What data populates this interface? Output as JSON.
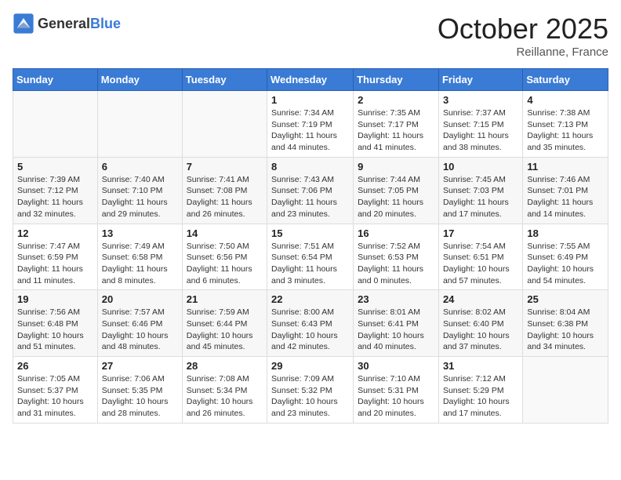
{
  "header": {
    "logo_general": "General",
    "logo_blue": "Blue",
    "month_title": "October 2025",
    "location": "Reillanne, France"
  },
  "days_of_week": [
    "Sunday",
    "Monday",
    "Tuesday",
    "Wednesday",
    "Thursday",
    "Friday",
    "Saturday"
  ],
  "weeks": [
    [
      {
        "day": "",
        "info": ""
      },
      {
        "day": "",
        "info": ""
      },
      {
        "day": "",
        "info": ""
      },
      {
        "day": "1",
        "info": "Sunrise: 7:34 AM\nSunset: 7:19 PM\nDaylight: 11 hours and 44 minutes."
      },
      {
        "day": "2",
        "info": "Sunrise: 7:35 AM\nSunset: 7:17 PM\nDaylight: 11 hours and 41 minutes."
      },
      {
        "day": "3",
        "info": "Sunrise: 7:37 AM\nSunset: 7:15 PM\nDaylight: 11 hours and 38 minutes."
      },
      {
        "day": "4",
        "info": "Sunrise: 7:38 AM\nSunset: 7:13 PM\nDaylight: 11 hours and 35 minutes."
      }
    ],
    [
      {
        "day": "5",
        "info": "Sunrise: 7:39 AM\nSunset: 7:12 PM\nDaylight: 11 hours and 32 minutes."
      },
      {
        "day": "6",
        "info": "Sunrise: 7:40 AM\nSunset: 7:10 PM\nDaylight: 11 hours and 29 minutes."
      },
      {
        "day": "7",
        "info": "Sunrise: 7:41 AM\nSunset: 7:08 PM\nDaylight: 11 hours and 26 minutes."
      },
      {
        "day": "8",
        "info": "Sunrise: 7:43 AM\nSunset: 7:06 PM\nDaylight: 11 hours and 23 minutes."
      },
      {
        "day": "9",
        "info": "Sunrise: 7:44 AM\nSunset: 7:05 PM\nDaylight: 11 hours and 20 minutes."
      },
      {
        "day": "10",
        "info": "Sunrise: 7:45 AM\nSunset: 7:03 PM\nDaylight: 11 hours and 17 minutes."
      },
      {
        "day": "11",
        "info": "Sunrise: 7:46 AM\nSunset: 7:01 PM\nDaylight: 11 hours and 14 minutes."
      }
    ],
    [
      {
        "day": "12",
        "info": "Sunrise: 7:47 AM\nSunset: 6:59 PM\nDaylight: 11 hours and 11 minutes."
      },
      {
        "day": "13",
        "info": "Sunrise: 7:49 AM\nSunset: 6:58 PM\nDaylight: 11 hours and 8 minutes."
      },
      {
        "day": "14",
        "info": "Sunrise: 7:50 AM\nSunset: 6:56 PM\nDaylight: 11 hours and 6 minutes."
      },
      {
        "day": "15",
        "info": "Sunrise: 7:51 AM\nSunset: 6:54 PM\nDaylight: 11 hours and 3 minutes."
      },
      {
        "day": "16",
        "info": "Sunrise: 7:52 AM\nSunset: 6:53 PM\nDaylight: 11 hours and 0 minutes."
      },
      {
        "day": "17",
        "info": "Sunrise: 7:54 AM\nSunset: 6:51 PM\nDaylight: 10 hours and 57 minutes."
      },
      {
        "day": "18",
        "info": "Sunrise: 7:55 AM\nSunset: 6:49 PM\nDaylight: 10 hours and 54 minutes."
      }
    ],
    [
      {
        "day": "19",
        "info": "Sunrise: 7:56 AM\nSunset: 6:48 PM\nDaylight: 10 hours and 51 minutes."
      },
      {
        "day": "20",
        "info": "Sunrise: 7:57 AM\nSunset: 6:46 PM\nDaylight: 10 hours and 48 minutes."
      },
      {
        "day": "21",
        "info": "Sunrise: 7:59 AM\nSunset: 6:44 PM\nDaylight: 10 hours and 45 minutes."
      },
      {
        "day": "22",
        "info": "Sunrise: 8:00 AM\nSunset: 6:43 PM\nDaylight: 10 hours and 42 minutes."
      },
      {
        "day": "23",
        "info": "Sunrise: 8:01 AM\nSunset: 6:41 PM\nDaylight: 10 hours and 40 minutes."
      },
      {
        "day": "24",
        "info": "Sunrise: 8:02 AM\nSunset: 6:40 PM\nDaylight: 10 hours and 37 minutes."
      },
      {
        "day": "25",
        "info": "Sunrise: 8:04 AM\nSunset: 6:38 PM\nDaylight: 10 hours and 34 minutes."
      }
    ],
    [
      {
        "day": "26",
        "info": "Sunrise: 7:05 AM\nSunset: 5:37 PM\nDaylight: 10 hours and 31 minutes."
      },
      {
        "day": "27",
        "info": "Sunrise: 7:06 AM\nSunset: 5:35 PM\nDaylight: 10 hours and 28 minutes."
      },
      {
        "day": "28",
        "info": "Sunrise: 7:08 AM\nSunset: 5:34 PM\nDaylight: 10 hours and 26 minutes."
      },
      {
        "day": "29",
        "info": "Sunrise: 7:09 AM\nSunset: 5:32 PM\nDaylight: 10 hours and 23 minutes."
      },
      {
        "day": "30",
        "info": "Sunrise: 7:10 AM\nSunset: 5:31 PM\nDaylight: 10 hours and 20 minutes."
      },
      {
        "day": "31",
        "info": "Sunrise: 7:12 AM\nSunset: 5:29 PM\nDaylight: 10 hours and 17 minutes."
      },
      {
        "day": "",
        "info": ""
      }
    ]
  ]
}
